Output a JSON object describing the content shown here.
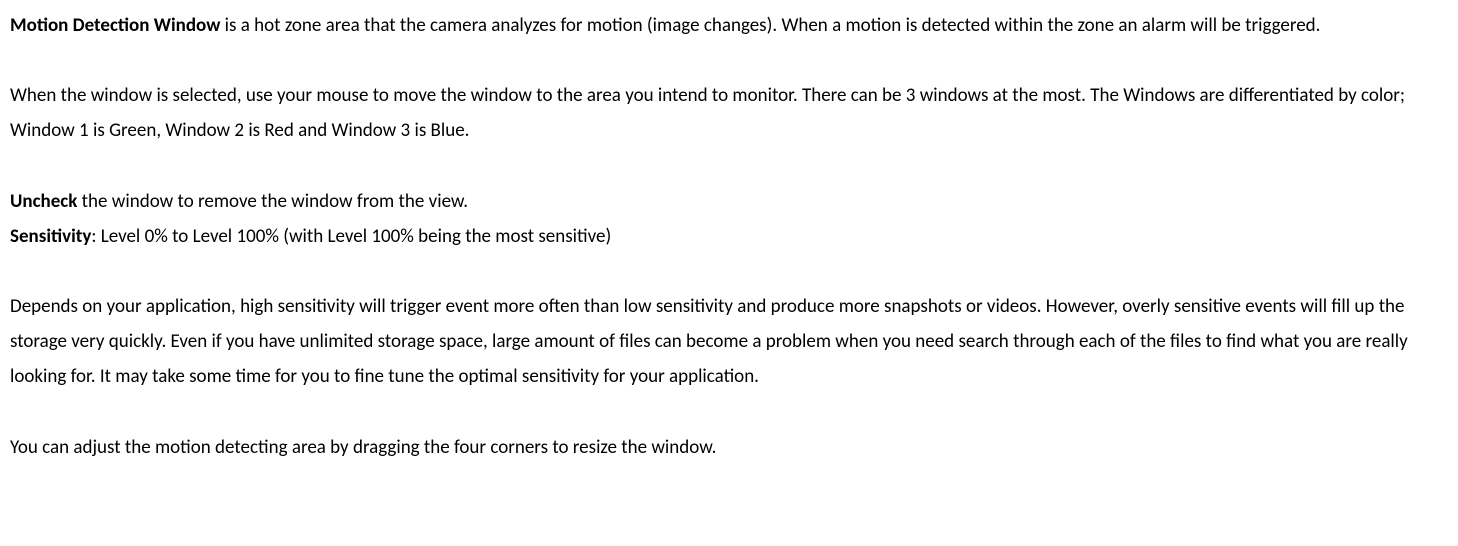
{
  "p1": {
    "bold": "Motion Detection Window",
    "rest": " is a hot zone area that the camera analyzes for motion (image changes). When a motion is detected within the zone an alarm will be triggered."
  },
  "p2": {
    "text": "When the window is selected, use your mouse to move the window to the area you intend to monitor. There can be 3 windows at the most. The Windows are differentiated by color; Window 1 is Green, Window 2 is Red and Window 3 is Blue."
  },
  "p3": {
    "line1_bold": "Uncheck",
    "line1_rest": " the window to remove the window from the view.",
    "line2_bold": "Sensitivity",
    "line2_rest": ": Level 0% to Level 100% (with Level 100% being the most sensitive)"
  },
  "p4": {
    "text": "Depends on your application, high sensitivity will trigger event more often than low sensitivity and produce more snapshots or videos. However, overly sensitive events will fill up the storage very quickly. Even if you have unlimited storage space, large amount of files can become a problem when you need search through each of the files to find what you are really looking for. It may take some time for you to fine tune the optimal sensitivity for your application."
  },
  "p5": {
    "text": "You can adjust the motion detecting area by dragging the four corners to resize the window."
  }
}
